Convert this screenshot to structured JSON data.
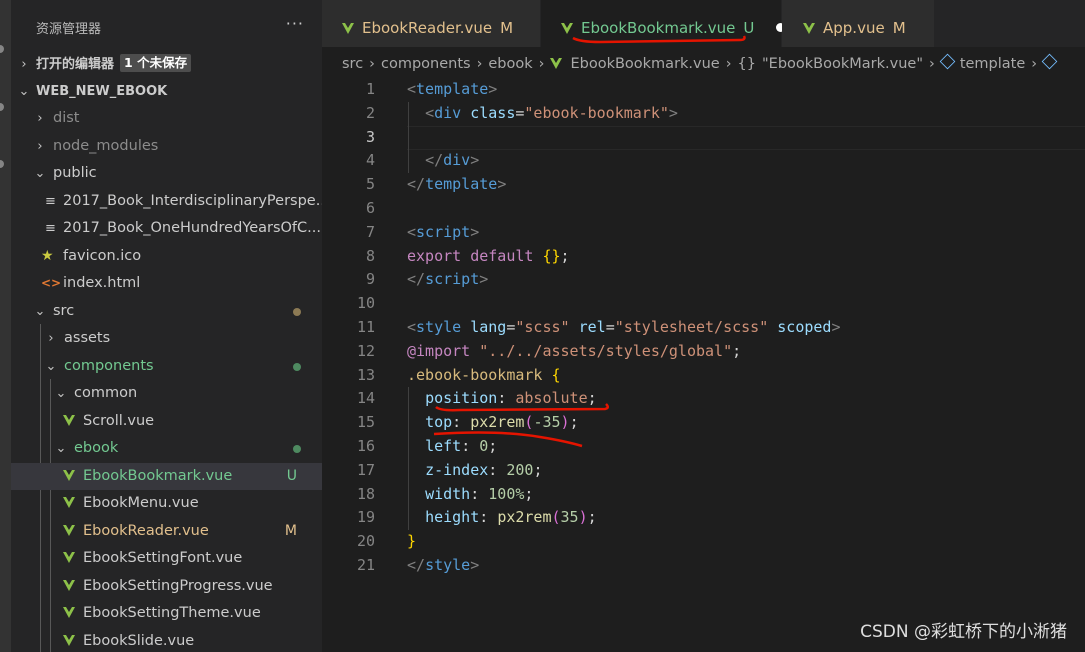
{
  "sidebar": {
    "title": "资源管理器",
    "more": "···",
    "open_editors": {
      "label": "打开的编辑器",
      "unsaved": "1 个未保存"
    },
    "project": "WEB_NEW_EBOOK",
    "tree": [
      {
        "label": "dist"
      },
      {
        "label": "node_modules"
      },
      {
        "label": "public"
      },
      {
        "label": "2017_Book_InterdisciplinaryPerspe..."
      },
      {
        "label": "2017_Book_OneHundredYearsOfC..."
      },
      {
        "label": "favicon.ico"
      },
      {
        "label": "index.html"
      },
      {
        "label": "src"
      },
      {
        "label": "assets"
      },
      {
        "label": "components"
      },
      {
        "label": "common"
      },
      {
        "label": "Scroll.vue"
      },
      {
        "label": "ebook"
      },
      {
        "label": "EbookBookmark.vue",
        "badge": "U"
      },
      {
        "label": "EbookMenu.vue"
      },
      {
        "label": "EbookReader.vue",
        "badge": "M"
      },
      {
        "label": "EbookSettingFont.vue"
      },
      {
        "label": "EbookSettingProgress.vue"
      },
      {
        "label": "EbookSettingTheme.vue"
      },
      {
        "label": "EbookSlide.vue"
      }
    ]
  },
  "tabs": [
    {
      "label": "EbookReader.vue",
      "badge": "M"
    },
    {
      "label": "EbookBookmark.vue",
      "badge": "U"
    },
    {
      "label": "App.vue",
      "badge": "M"
    }
  ],
  "breadcrumb": {
    "src": "src",
    "components": "components",
    "ebook": "ebook",
    "file": "EbookBookmark.vue",
    "obj_sym": "{}",
    "object": "\"EbookBookMark.vue\"",
    "template": "template"
  },
  "editor": {
    "line_numbers": [
      "1",
      "2",
      "3",
      "4",
      "5",
      "6",
      "7",
      "8",
      "9",
      "10",
      "11",
      "12",
      "13",
      "14",
      "15",
      "16",
      "17",
      "18",
      "19",
      "20",
      "21"
    ],
    "lines": [
      [
        {
          "t": "<",
          "c": "tb"
        },
        {
          "t": "template",
          "c": "tg"
        },
        {
          "t": ">",
          "c": "tb"
        }
      ],
      [
        {
          "t": "  "
        },
        {
          "t": "<",
          "c": "tb"
        },
        {
          "t": "div",
          "c": "tg"
        },
        {
          "t": " "
        },
        {
          "t": "class",
          "c": "at"
        },
        {
          "t": "=",
          "c": "pu"
        },
        {
          "t": "\"ebook-bookmark\"",
          "c": "st"
        },
        {
          "t": ">",
          "c": "tb"
        }
      ],
      [],
      [
        {
          "t": "  "
        },
        {
          "t": "</",
          "c": "tb"
        },
        {
          "t": "div",
          "c": "tg"
        },
        {
          "t": ">",
          "c": "tb"
        }
      ],
      [
        {
          "t": "</",
          "c": "tb"
        },
        {
          "t": "template",
          "c": "tg"
        },
        {
          "t": ">",
          "c": "tb"
        }
      ],
      [],
      [
        {
          "t": "<",
          "c": "tb"
        },
        {
          "t": "script",
          "c": "tg"
        },
        {
          "t": ">",
          "c": "tb"
        }
      ],
      [
        {
          "t": "export",
          "c": "kc"
        },
        {
          "t": " "
        },
        {
          "t": "default",
          "c": "kc"
        },
        {
          "t": " "
        },
        {
          "t": "{}",
          "c": "br"
        },
        {
          "t": ";",
          "c": "pu"
        }
      ],
      [
        {
          "t": "</",
          "c": "tb"
        },
        {
          "t": "script",
          "c": "tg"
        },
        {
          "t": ">",
          "c": "tb"
        }
      ],
      [],
      [
        {
          "t": "<",
          "c": "tb"
        },
        {
          "t": "style",
          "c": "tg"
        },
        {
          "t": " "
        },
        {
          "t": "lang",
          "c": "at"
        },
        {
          "t": "=",
          "c": "pu"
        },
        {
          "t": "\"scss\"",
          "c": "st"
        },
        {
          "t": " "
        },
        {
          "t": "rel",
          "c": "at"
        },
        {
          "t": "=",
          "c": "pu"
        },
        {
          "t": "\"stylesheet/scss\"",
          "c": "st"
        },
        {
          "t": " "
        },
        {
          "t": "scoped",
          "c": "at"
        },
        {
          "t": ">",
          "c": "tb"
        }
      ],
      [
        {
          "t": "@import",
          "c": "kc"
        },
        {
          "t": " "
        },
        {
          "t": "\"../../assets/styles/global\"",
          "c": "st"
        },
        {
          "t": ";",
          "c": "pu"
        }
      ],
      [
        {
          "t": ".ebook-bookmark",
          "c": "sel"
        },
        {
          "t": " "
        },
        {
          "t": "{",
          "c": "br"
        }
      ],
      [
        {
          "t": "  "
        },
        {
          "t": "position",
          "c": "pr"
        },
        {
          "t": ": ",
          "c": "pu"
        },
        {
          "t": "absolute",
          "c": "st"
        },
        {
          "t": ";",
          "c": "pu"
        }
      ],
      [
        {
          "t": "  "
        },
        {
          "t": "top",
          "c": "pr"
        },
        {
          "t": ": ",
          "c": "pu"
        },
        {
          "t": "px2rem",
          "c": "fn"
        },
        {
          "t": "(",
          "c": "br2"
        },
        {
          "t": "-35",
          "c": "nm"
        },
        {
          "t": ")",
          "c": "br2"
        },
        {
          "t": ";",
          "c": "pu"
        }
      ],
      [
        {
          "t": "  "
        },
        {
          "t": "left",
          "c": "pr"
        },
        {
          "t": ": ",
          "c": "pu"
        },
        {
          "t": "0",
          "c": "nm"
        },
        {
          "t": ";",
          "c": "pu"
        }
      ],
      [
        {
          "t": "  "
        },
        {
          "t": "z-index",
          "c": "pr"
        },
        {
          "t": ": ",
          "c": "pu"
        },
        {
          "t": "200",
          "c": "nm"
        },
        {
          "t": ";",
          "c": "pu"
        }
      ],
      [
        {
          "t": "  "
        },
        {
          "t": "width",
          "c": "pr"
        },
        {
          "t": ": ",
          "c": "pu"
        },
        {
          "t": "100%",
          "c": "nm"
        },
        {
          "t": ";",
          "c": "pu"
        }
      ],
      [
        {
          "t": "  "
        },
        {
          "t": "height",
          "c": "pr"
        },
        {
          "t": ": ",
          "c": "pu"
        },
        {
          "t": "px2rem",
          "c": "fn"
        },
        {
          "t": "(",
          "c": "br2"
        },
        {
          "t": "35",
          "c": "nm"
        },
        {
          "t": ")",
          "c": "br2"
        },
        {
          "t": ";",
          "c": "pu"
        }
      ],
      [
        {
          "t": "}",
          "c": "br"
        }
      ],
      [
        {
          "t": "</",
          "c": "tb"
        },
        {
          "t": "style",
          "c": "tg"
        },
        {
          "t": ">",
          "c": "tb"
        }
      ]
    ]
  },
  "watermark": "CSDN @彩虹桥下的小淅猪",
  "colors": {
    "untracked": "#73c991",
    "modified": "#e2c08d",
    "annotation": "#e51400",
    "vue": "#8dc149"
  }
}
